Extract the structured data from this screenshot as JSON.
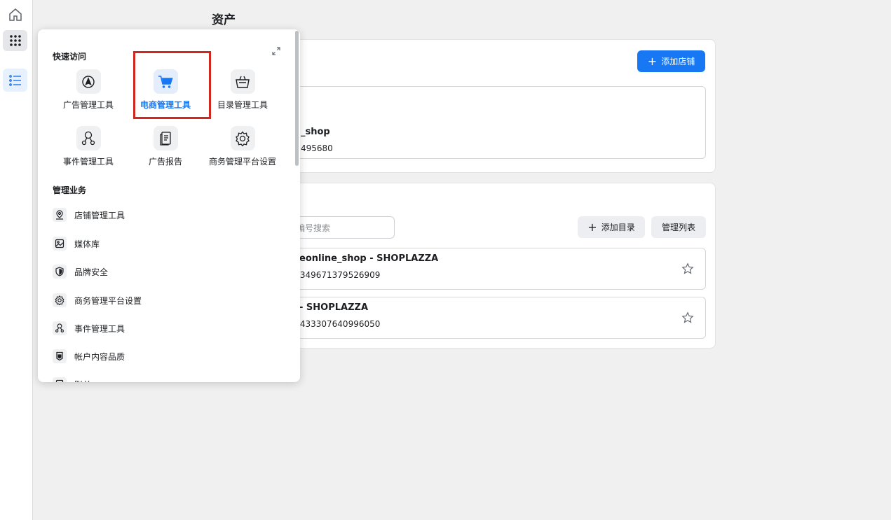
{
  "page": {
    "title": "资产"
  },
  "shops": {
    "add_button": "添加店铺",
    "shop_name": "_shop",
    "shop_id": "495680"
  },
  "catalogs": {
    "search_placeholder": "编号搜索",
    "add_button": "添加目录",
    "manage_button": "管理列表",
    "rows": [
      {
        "name": "eonline_shop - SHOPLAZZA",
        "id": ": 349671379526909"
      },
      {
        "name": "- SHOPLAZZA",
        "id": ": 433307640996050"
      }
    ]
  },
  "popup": {
    "quick_access_title": "快速访问",
    "tools": [
      {
        "label": "广告管理工具",
        "icon": "navigation-icon"
      },
      {
        "label": "电商管理工具",
        "icon": "cart-icon"
      },
      {
        "label": "目录管理工具",
        "icon": "shopping-bag-icon"
      },
      {
        "label": "事件管理工具",
        "icon": "events-icon"
      },
      {
        "label": "广告报告",
        "icon": "report-icon"
      },
      {
        "label": "商务管理平台设置",
        "icon": "gear-icon"
      }
    ],
    "manage_title": "管理业务",
    "items": [
      {
        "label": "店铺管理工具",
        "icon": "location-icon"
      },
      {
        "label": "媒体库",
        "icon": "media-icon"
      },
      {
        "label": "品牌安全",
        "icon": "shield-icon"
      },
      {
        "label": "商务管理平台设置",
        "icon": "gear-icon"
      },
      {
        "label": "事件管理工具",
        "icon": "events-icon"
      },
      {
        "label": "帐户内容品质",
        "icon": "quality-icon"
      },
      {
        "label": "账单",
        "icon": "billing-icon"
      }
    ]
  },
  "colors": {
    "accent": "#1877f2",
    "highlight": "#d0281e"
  }
}
